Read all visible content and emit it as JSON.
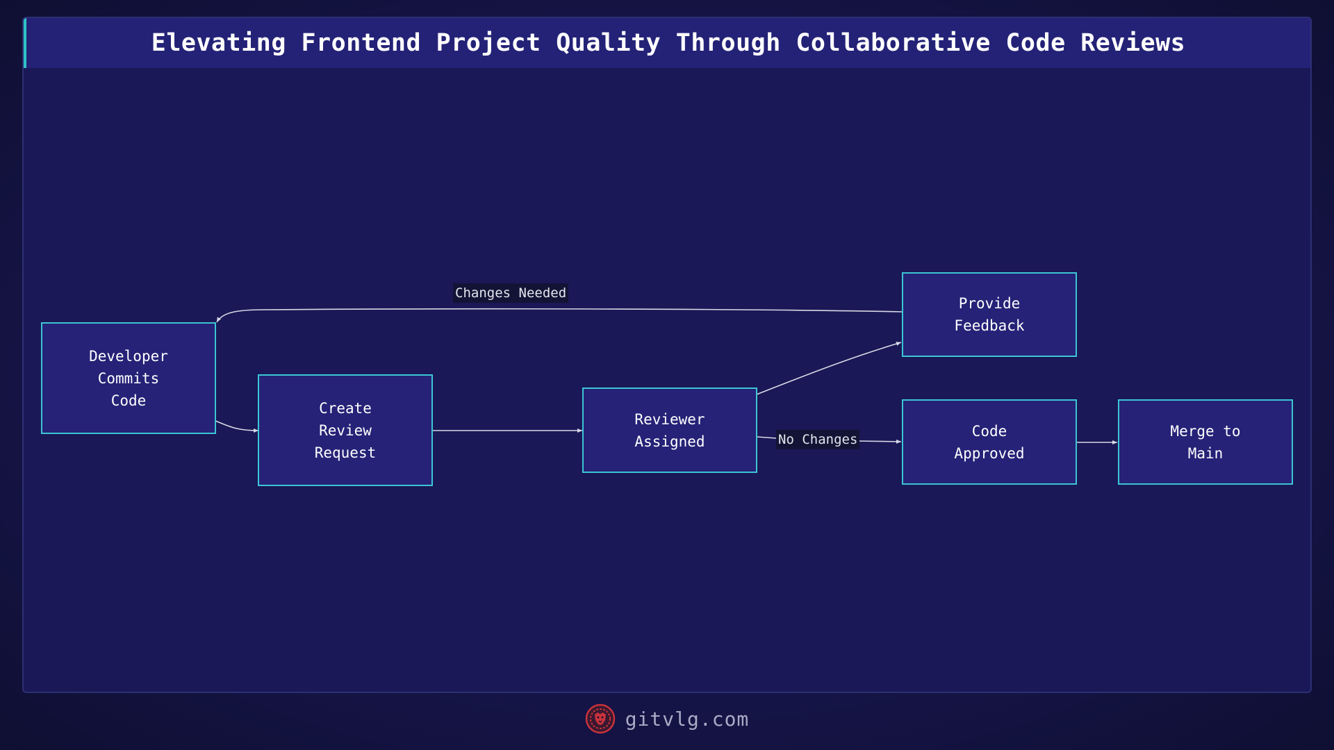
{
  "title": "Elevating Frontend Project Quality Through Collaborative Code Reviews",
  "nodes": {
    "developer_commits": "Developer\nCommits\nCode",
    "create_review": "Create\nReview\nRequest",
    "reviewer_assigned": "Reviewer\nAssigned",
    "provide_feedback": "Provide\nFeedback",
    "code_approved": "Code\nApproved",
    "merge_main": "Merge to\nMain"
  },
  "edges": {
    "changes_needed": "Changes Needed",
    "no_changes": "No Changes"
  },
  "footer": {
    "site": "gitvlg.com",
    "logo_icon": "lion-head-icon"
  },
  "colors": {
    "background": "#16154a",
    "panel": "#1a1856",
    "title_bar": "#242277",
    "node_fill": "#252277",
    "node_border": "#3cc6d4",
    "accent": "#2ec4c4",
    "edge": "#d8d8e6",
    "logo": "#c8323c"
  }
}
